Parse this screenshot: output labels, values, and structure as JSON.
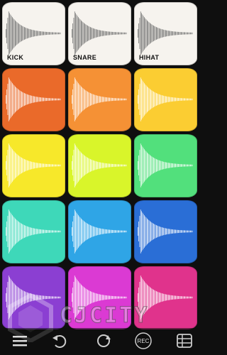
{
  "pads": [
    {
      "label": "KICK",
      "color": "#f6f3ee",
      "wave": "#6b6b6b",
      "row": 1,
      "col": 1
    },
    {
      "label": "SNARE",
      "color": "#f6f3ee",
      "wave": "#6b6b6b",
      "row": 1,
      "col": 2
    },
    {
      "label": "HIHAT",
      "color": "#f6f3ee",
      "wave": "#6b6b6b",
      "row": 1,
      "col": 3
    },
    {
      "label": "",
      "color": "#ea6a2a",
      "wave": "#ffffff",
      "row": 2,
      "col": 1
    },
    {
      "label": "",
      "color": "#f59135",
      "wave": "#ffffff",
      "row": 2,
      "col": 2
    },
    {
      "label": "",
      "color": "#fbcd32",
      "wave": "#ffffff",
      "row": 2,
      "col": 3
    },
    {
      "label": "",
      "color": "#f7e82a",
      "wave": "#ffffff",
      "row": 3,
      "col": 1
    },
    {
      "label": "",
      "color": "#d9f52a",
      "wave": "#ffffff",
      "row": 3,
      "col": 2
    },
    {
      "label": "",
      "color": "#52e07c",
      "wave": "#ffffff",
      "row": 3,
      "col": 3
    },
    {
      "label": "",
      "color": "#3ed8b9",
      "wave": "#ffffff",
      "row": 4,
      "col": 1
    },
    {
      "label": "",
      "color": "#2fa5e6",
      "wave": "#ffffff",
      "row": 4,
      "col": 2
    },
    {
      "label": "",
      "color": "#2a6ed6",
      "wave": "#ffffff",
      "row": 4,
      "col": 3
    },
    {
      "label": "",
      "color": "#8b3fd2",
      "wave": "#ffffff",
      "row": 5,
      "col": 1
    },
    {
      "label": "",
      "color": "#db3ad3",
      "wave": "#ffffff",
      "row": 5,
      "col": 2
    },
    {
      "label": "",
      "color": "#e0338c",
      "wave": "#ffffff",
      "row": 5,
      "col": 3
    }
  ],
  "toolbar": {
    "rec_label": "REC",
    "icons": [
      "menu-icon",
      "undo-icon",
      "loop-icon",
      "rec-icon",
      "grid-icon"
    ]
  },
  "watermark": {
    "text": "CJCITY"
  }
}
